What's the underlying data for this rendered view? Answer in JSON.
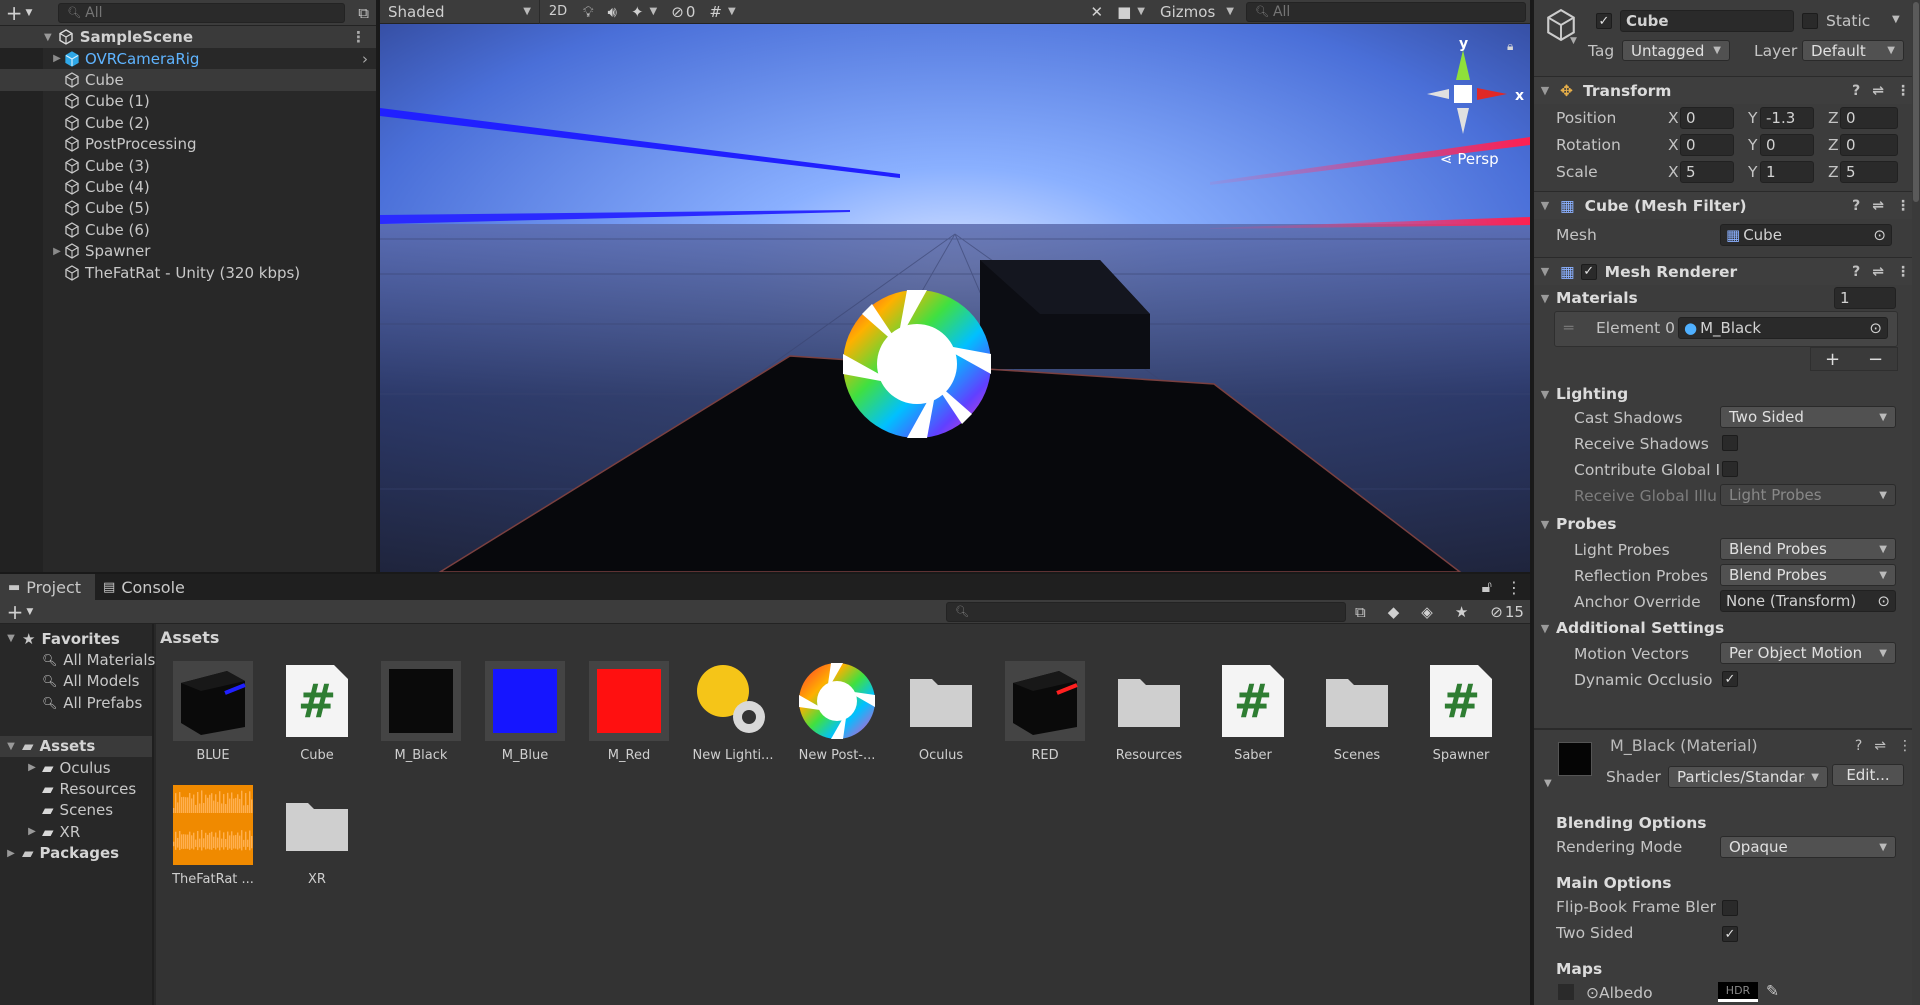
{
  "hierarchy": {
    "search_placeholder": "All",
    "scene_name": "SampleScene",
    "items": [
      {
        "label": "OVRCameraRig",
        "expandable": true,
        "prefab": true
      },
      {
        "label": "Cube",
        "expandable": false,
        "selected": true
      },
      {
        "label": "Cube (1)",
        "expandable": false
      },
      {
        "label": "Cube (2)",
        "expandable": false
      },
      {
        "label": "PostProcessing",
        "expandable": false
      },
      {
        "label": "Cube (3)",
        "expandable": false
      },
      {
        "label": "Cube (4)",
        "expandable": false
      },
      {
        "label": "Cube (5)",
        "expandable": false
      },
      {
        "label": "Cube (6)",
        "expandable": false
      },
      {
        "label": "Spawner",
        "expandable": true
      },
      {
        "label": "TheFatRat - Unity (320  kbps)",
        "expandable": false
      }
    ]
  },
  "scene_toolbar": {
    "shading_mode": "Shaded",
    "mode_2d": "2D",
    "hidden_count": "0",
    "gizmos": "Gizmos",
    "search_placeholder": "All",
    "persp_label": "Persp",
    "axis_y": "y",
    "axis_x": "x"
  },
  "project": {
    "tabs": [
      {
        "label": "Project"
      },
      {
        "label": "Console"
      }
    ],
    "hidden_count": "15",
    "favorites_label": "Favorites",
    "favorites": [
      "All Materials",
      "All Models",
      "All Prefabs"
    ],
    "assets_label": "Assets",
    "asset_folders": [
      {
        "label": "Oculus",
        "expandable": true
      },
      {
        "label": "Resources",
        "expandable": false
      },
      {
        "label": "Scenes",
        "expandable": false
      },
      {
        "label": "XR",
        "expandable": true
      }
    ],
    "packages_label": "Packages",
    "breadcrumb": "Assets",
    "assets": [
      {
        "label": "BLUE",
        "kind": "prefab-blue"
      },
      {
        "label": "Cube",
        "kind": "script"
      },
      {
        "label": "M_Black",
        "kind": "material",
        "color": "#0a0a0a"
      },
      {
        "label": "M_Blue",
        "kind": "material",
        "color": "#1515ff"
      },
      {
        "label": "M_Red",
        "kind": "material",
        "color": "#ff1010"
      },
      {
        "label": "New Lighti...",
        "kind": "lighting"
      },
      {
        "label": "New Post-...",
        "kind": "postfx"
      },
      {
        "label": "Oculus",
        "kind": "folder"
      },
      {
        "label": "RED",
        "kind": "prefab-red"
      },
      {
        "label": "Resources",
        "kind": "folder"
      },
      {
        "label": "Saber",
        "kind": "script"
      },
      {
        "label": "Scenes",
        "kind": "folder"
      },
      {
        "label": "Spawner",
        "kind": "script"
      },
      {
        "label": "TheFatRat ...",
        "kind": "audio"
      },
      {
        "label": "XR",
        "kind": "folder"
      }
    ]
  },
  "inspector": {
    "object_name": "Cube",
    "static_label": "Static",
    "tag_label": "Tag",
    "tag_value": "Untagged",
    "layer_label": "Layer",
    "layer_value": "Default",
    "transform": {
      "title": "Transform",
      "position_label": "Position",
      "position": {
        "x": "0",
        "y": "-1.3",
        "z": "0"
      },
      "rotation_label": "Rotation",
      "rotation": {
        "x": "0",
        "y": "0",
        "z": "0"
      },
      "scale_label": "Scale",
      "scale": {
        "x": "5",
        "y": "1",
        "z": "5"
      }
    },
    "mesh_filter": {
      "title": "Cube (Mesh Filter)",
      "mesh_label": "Mesh",
      "mesh_value": "Cube"
    },
    "mesh_renderer": {
      "title": "Mesh Renderer",
      "materials_label": "Materials",
      "materials_count": "1",
      "element0_label": "Element 0",
      "element0_value": "M_Black",
      "lighting_label": "Lighting",
      "cast_shadows_label": "Cast Shadows",
      "cast_shadows_value": "Two Sided",
      "receive_shadows_label": "Receive Shadows",
      "contribute_gi_label": "Contribute Global I",
      "receive_gi_label": "Receive Global Illu",
      "receive_gi_value": "Light Probes",
      "probes_label": "Probes",
      "light_probes_label": "Light Probes",
      "light_probes_value": "Blend Probes",
      "reflection_probes_label": "Reflection Probes",
      "reflection_probes_value": "Blend Probes",
      "anchor_override_label": "Anchor Override",
      "anchor_override_value": "None (Transform)",
      "additional_label": "Additional Settings",
      "motion_vectors_label": "Motion Vectors",
      "motion_vectors_value": "Per Object Motion",
      "dynamic_occlusion_label": "Dynamic Occlusio"
    },
    "material": {
      "title": "M_Black (Material)",
      "shader_label": "Shader",
      "shader_value": "Particles/Standard",
      "edit_label": "Edit...",
      "blending_label": "Blending Options",
      "rendering_mode_label": "Rendering Mode",
      "rendering_mode_value": "Opaque",
      "main_options_label": "Main Options",
      "flipbook_label": "Flip-Book Frame Bler",
      "two_sided_label": "Two Sided",
      "maps_label": "Maps",
      "albedo_label": "Albedo",
      "hdr_label": "HDR"
    }
  }
}
